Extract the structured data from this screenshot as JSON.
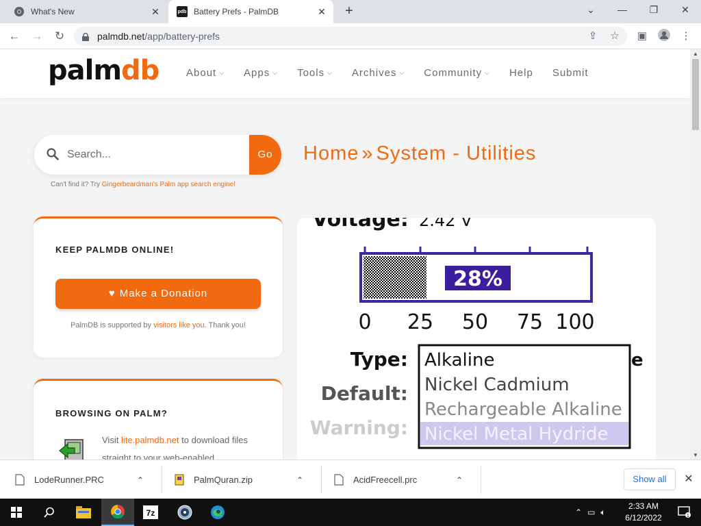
{
  "browser": {
    "tabs": [
      {
        "title": "What's New"
      },
      {
        "title": "Battery Prefs - PalmDB"
      }
    ],
    "favicon_text": "pdb",
    "url_host": "palmdb.net",
    "url_path": "/app/battery-prefs"
  },
  "site": {
    "logo_left": "palm",
    "logo_right": "db",
    "nav": [
      {
        "label": "About",
        "dropdown": true
      },
      {
        "label": "Apps",
        "dropdown": true
      },
      {
        "label": "Tools",
        "dropdown": true
      },
      {
        "label": "Archives",
        "dropdown": true
      },
      {
        "label": "Community",
        "dropdown": true
      },
      {
        "label": "Help",
        "dropdown": false
      },
      {
        "label": "Submit",
        "dropdown": false
      }
    ],
    "accent_color": "#f26a10"
  },
  "search": {
    "placeholder": "Search...",
    "button": "Go",
    "hint_prefix": "Can't find it? Try ",
    "hint_link": "Gingerbeardman's Palm app search engine!"
  },
  "breadcrumb": {
    "home": "Home",
    "separator": "»",
    "current": "System - Utilities"
  },
  "donate_card": {
    "title": "KEEP PALMDB ONLINE!",
    "button": "Make a Donation",
    "note_prefix": "PalmDB is supported by ",
    "note_link": "visitors like you",
    "note_suffix": ". Thank you!"
  },
  "palm_card": {
    "title": "BROWSING ON PALM?",
    "text_prefix": "Visit ",
    "text_link": "lite.palmdb.net",
    "text_suffix": " to download files straight to your web-enabled"
  },
  "screenshot": {
    "voltage_label": "Voltage:",
    "voltage_value": "2.42 V",
    "percent_text": "28%",
    "battery_level_pct": 28,
    "scale_ticks": [
      "0",
      "25",
      "50",
      "75",
      "100"
    ],
    "type_label": "Type:",
    "default_label": "Default:",
    "warning_label": "Warning:",
    "options": [
      "Alkaline",
      "Nickel Cadmium",
      "Rechargeable Alkaline",
      "Nickel Metal Hydride"
    ],
    "trailing_char": "e"
  },
  "downloads": {
    "items": [
      {
        "name": "LodeRunner.PRC"
      },
      {
        "name": "PalmQuran.zip"
      },
      {
        "name": "AcidFreecell.prc"
      }
    ],
    "show_all": "Show all"
  },
  "taskbar": {
    "time": "2:33 AM",
    "date": "6/12/2022",
    "notification_count": "1"
  }
}
